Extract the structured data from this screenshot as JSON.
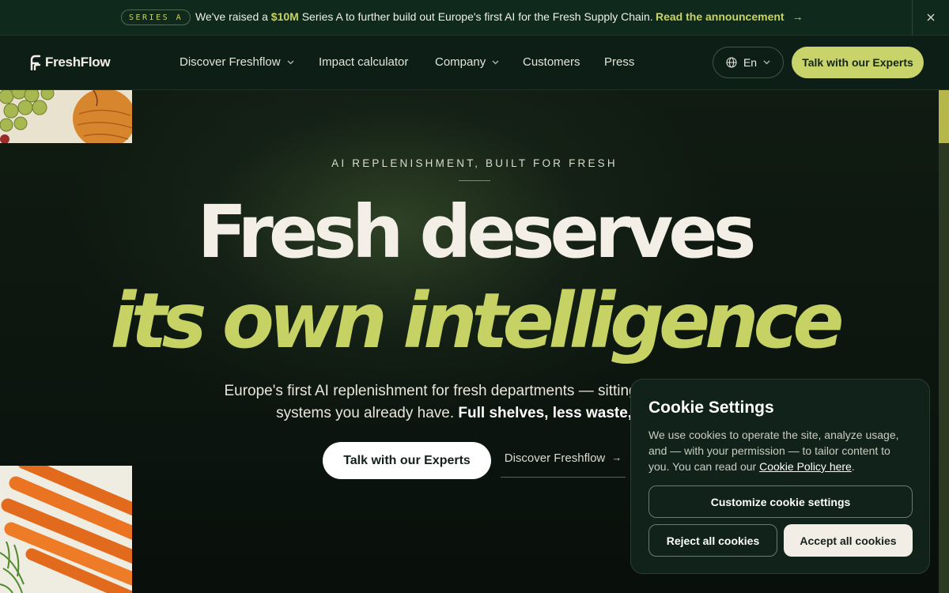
{
  "announcement": {
    "badge": "SERIES A",
    "msg_prefix": "We've raised a ",
    "msg_amount": "$10M",
    "msg_suffix": " Series A to further build out Europe's first AI for the Fresh Supply Chain.",
    "link_label": "Read the announcement",
    "link_arrow": "→",
    "close_icon": "close-icon"
  },
  "header": {
    "logo_text": "FreshFlow",
    "nav": [
      {
        "label": "Discover Freshflow",
        "has_dropdown": true
      },
      {
        "label": "Impact calculator",
        "has_dropdown": false
      },
      {
        "label": "Company",
        "has_dropdown": true
      },
      {
        "label": "Customers",
        "has_dropdown": false
      },
      {
        "label": "Press",
        "has_dropdown": false
      }
    ],
    "language": "En",
    "cta_label": "Talk with our Experts"
  },
  "hero": {
    "eyebrow": "AI REPLENISHMENT, BUILT FOR FRESH",
    "headline_line1": "Fresh deserves",
    "headline_line2": "its own intelligence",
    "sub_regular": "Europe's first AI replenishment for fresh departments — sitting on top of the systems you already have. ",
    "sub_bold": "Full shelves, less waste, more",
    "primary_cta": "Talk with our Experts",
    "secondary_cta": "Discover Freshflow",
    "secondary_arrow": "→"
  },
  "cookie": {
    "title": "Cookie Settings",
    "text": "We use cookies to operate the site, analyze usage, and — with your permission — to tailor content to you. You can read our ",
    "policy_link": "Cookie Policy here",
    "text_end": ".",
    "customize_label": "Customize cookie settings",
    "reject_label": "Reject all cookies",
    "accept_label": "Accept all cookies"
  },
  "colors": {
    "accent_lime": "#c8d36a",
    "dark_green": "#0f2a1c",
    "cream": "#f4efe6"
  }
}
